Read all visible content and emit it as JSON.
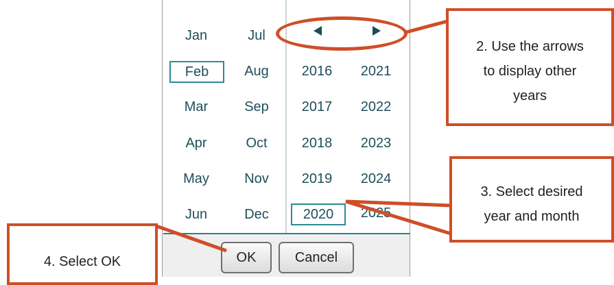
{
  "months_col1": [
    "Jan",
    "Feb",
    "Mar",
    "Apr",
    "May",
    "Jun"
  ],
  "months_col2": [
    "Jul",
    "Aug",
    "Sep",
    "Oct",
    "Nov",
    "Dec"
  ],
  "years_col1": [
    "2016",
    "2017",
    "2018",
    "2019",
    "2020"
  ],
  "years_col2": [
    "2021",
    "2022",
    "2023",
    "2024",
    "2025"
  ],
  "selected_month": "Feb",
  "selected_year": "2020",
  "buttons": {
    "ok": "OK",
    "cancel": "Cancel"
  },
  "callouts": {
    "arrows": [
      "2. Use the arrows",
      "to display other",
      "years"
    ],
    "select": [
      "3. Select desired",
      "year and month"
    ],
    "ok": "4. Select OK"
  },
  "colors": {
    "callout_border": "#cf4e28",
    "accent": "#2e8a92",
    "text": "#1e4f5a"
  }
}
